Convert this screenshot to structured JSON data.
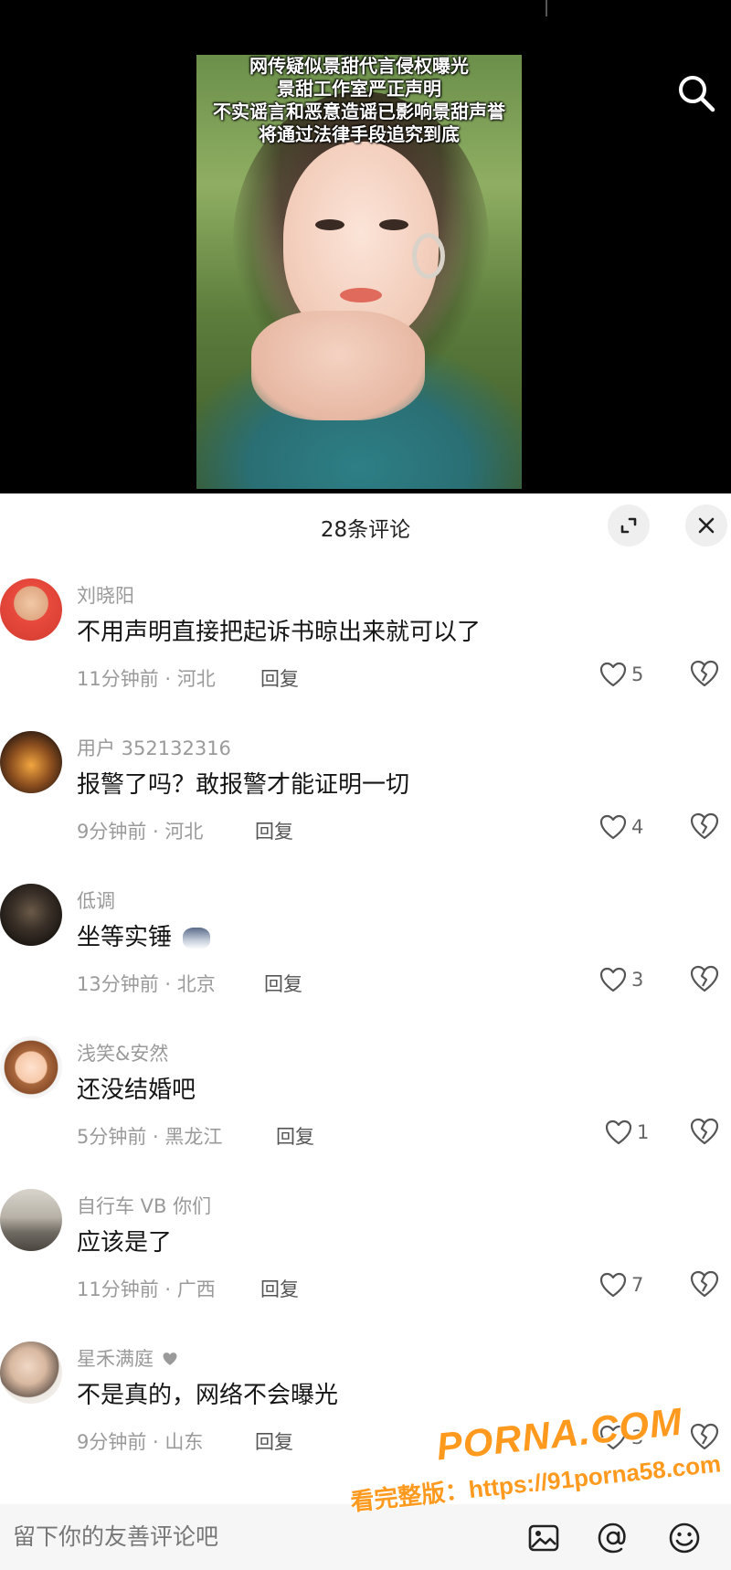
{
  "video": {
    "overlay_lines": [
      "网传疑似景甜代言侵权曝光",
      "景甜工作室严正声明",
      "不实谣言和恶意造谣已影响景甜声誉",
      "将通过法律手段追究到底"
    ],
    "search_icon": "search-icon"
  },
  "comments_panel": {
    "title": "28条评论",
    "expand_icon": "expand-icon",
    "close_icon": "close-icon"
  },
  "comments": [
    {
      "username": "刘晓阳",
      "text": "不用声明直接把起诉书晾出来就可以了",
      "meta": "11分钟前 · 河北",
      "reply": "回复",
      "likes": "5"
    },
    {
      "username": "用户 352132316",
      "text": "报警了吗？敢报警才能证明一切",
      "meta": "9分钟前 · 河北",
      "reply": "回复",
      "likes": "4"
    },
    {
      "username": "低调",
      "text": "坐等实锤",
      "meta": "13分钟前 · 北京",
      "reply": "回复",
      "likes": "3"
    },
    {
      "username": "浅笑&安然",
      "text": "还没结婚吧",
      "meta": "5分钟前 · 黑龙江",
      "reply": "回复",
      "likes": "1"
    },
    {
      "username": "自行车 VB 你们",
      "text": "应该是了",
      "meta": "11分钟前 · 广西",
      "reply": "回复",
      "likes": "7"
    },
    {
      "username": "星禾满庭",
      "text": "不是真的，网络不会曝光",
      "meta": "9分钟前 · 山东",
      "reply": "回复",
      "likes": "3"
    }
  ],
  "bottom_bar": {
    "placeholder": "留下你的友善评论吧",
    "icons": [
      "image-icon",
      "at-icon",
      "emoji-icon"
    ]
  },
  "watermark": {
    "logo": "PORNA.COM",
    "url": "看完整版：https://91porna58.com"
  },
  "colors": {
    "like_heart": "#555555",
    "watermark": "#ff9a1f",
    "muted_text": "#9a9a9a"
  }
}
